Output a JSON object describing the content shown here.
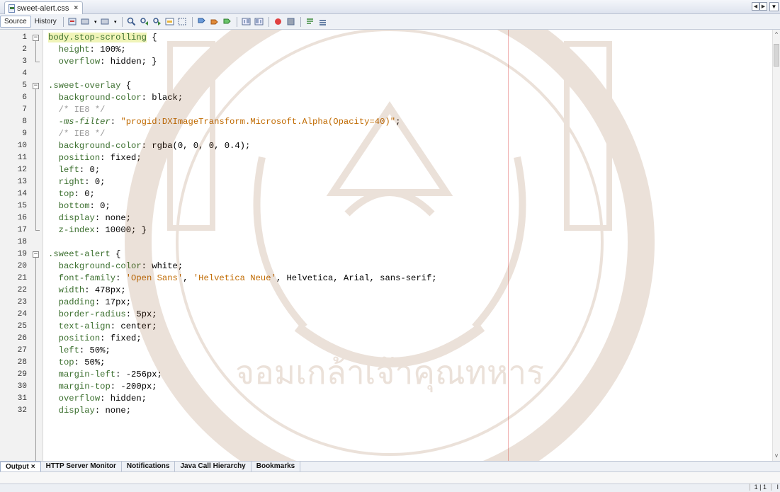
{
  "editor_tab": {
    "filename": "sweet-alert.css",
    "close": "×"
  },
  "toolbar": {
    "source": "Source",
    "history": "History"
  },
  "code_lines": [
    {
      "n": "1",
      "fold": "open",
      "parts": [
        [
          "sel-hl",
          "body.stop-scrolling"
        ],
        [
          "",
          " {"
        ]
      ]
    },
    {
      "n": "2",
      "parts": [
        [
          "",
          "  "
        ],
        [
          "prop",
          "height"
        ],
        [
          "",
          ": 100%;"
        ]
      ]
    },
    {
      "n": "3",
      "fold": "end",
      "parts": [
        [
          "",
          "  "
        ],
        [
          "prop",
          "overflow"
        ],
        [
          "",
          ": hidden; }"
        ]
      ]
    },
    {
      "n": "4",
      "parts": []
    },
    {
      "n": "5",
      "fold": "open",
      "parts": [
        [
          "sel",
          ".sweet-overlay"
        ],
        [
          "",
          " {"
        ]
      ]
    },
    {
      "n": "6",
      "parts": [
        [
          "",
          "  "
        ],
        [
          "prop",
          "background-color"
        ],
        [
          "",
          ": black;"
        ]
      ]
    },
    {
      "n": "7",
      "parts": [
        [
          "",
          "  "
        ],
        [
          "cmt",
          "/* IE8 */"
        ]
      ]
    },
    {
      "n": "8",
      "parts": [
        [
          "",
          "  "
        ],
        [
          "prop-i",
          "-ms-filter"
        ],
        [
          "",
          ": "
        ],
        [
          "str",
          "\"progid:DXImageTransform.Microsoft.Alpha(Opacity=40)\""
        ],
        [
          "",
          ";"
        ]
      ]
    },
    {
      "n": "9",
      "parts": [
        [
          "",
          "  "
        ],
        [
          "cmt",
          "/* IE8 */"
        ]
      ]
    },
    {
      "n": "10",
      "parts": [
        [
          "",
          "  "
        ],
        [
          "prop",
          "background-color"
        ],
        [
          "",
          ": rgba(0, 0, 0, 0.4);"
        ]
      ]
    },
    {
      "n": "11",
      "parts": [
        [
          "",
          "  "
        ],
        [
          "prop",
          "position"
        ],
        [
          "",
          ": fixed;"
        ]
      ]
    },
    {
      "n": "12",
      "parts": [
        [
          "",
          "  "
        ],
        [
          "prop",
          "left"
        ],
        [
          "",
          ": 0;"
        ]
      ]
    },
    {
      "n": "13",
      "parts": [
        [
          "",
          "  "
        ],
        [
          "prop",
          "right"
        ],
        [
          "",
          ": 0;"
        ]
      ]
    },
    {
      "n": "14",
      "parts": [
        [
          "",
          "  "
        ],
        [
          "prop",
          "top"
        ],
        [
          "",
          ": 0;"
        ]
      ]
    },
    {
      "n": "15",
      "parts": [
        [
          "",
          "  "
        ],
        [
          "prop",
          "bottom"
        ],
        [
          "",
          ": 0;"
        ]
      ]
    },
    {
      "n": "16",
      "parts": [
        [
          "",
          "  "
        ],
        [
          "prop",
          "display"
        ],
        [
          "",
          ": none;"
        ]
      ]
    },
    {
      "n": "17",
      "fold": "end",
      "parts": [
        [
          "",
          "  "
        ],
        [
          "prop",
          "z-index"
        ],
        [
          "",
          ": 10000; }"
        ]
      ]
    },
    {
      "n": "18",
      "parts": []
    },
    {
      "n": "19",
      "fold": "open",
      "parts": [
        [
          "sel",
          ".sweet-alert"
        ],
        [
          "",
          " {"
        ]
      ]
    },
    {
      "n": "20",
      "parts": [
        [
          "",
          "  "
        ],
        [
          "prop",
          "background-color"
        ],
        [
          "",
          ": white;"
        ]
      ]
    },
    {
      "n": "21",
      "parts": [
        [
          "",
          "  "
        ],
        [
          "prop",
          "font-family"
        ],
        [
          "",
          ": "
        ],
        [
          "str",
          "'Open Sans'"
        ],
        [
          "",
          ", "
        ],
        [
          "str",
          "'Helvetica Neue'"
        ],
        [
          "",
          ", Helvetica, Arial, sans-serif;"
        ]
      ]
    },
    {
      "n": "22",
      "parts": [
        [
          "",
          "  "
        ],
        [
          "prop",
          "width"
        ],
        [
          "",
          ": 478px;"
        ]
      ]
    },
    {
      "n": "23",
      "parts": [
        [
          "",
          "  "
        ],
        [
          "prop",
          "padding"
        ],
        [
          "",
          ": 17px;"
        ]
      ]
    },
    {
      "n": "24",
      "parts": [
        [
          "",
          "  "
        ],
        [
          "prop",
          "border-radius"
        ],
        [
          "",
          ": 5px;"
        ]
      ]
    },
    {
      "n": "25",
      "parts": [
        [
          "",
          "  "
        ],
        [
          "prop",
          "text-align"
        ],
        [
          "",
          ": center;"
        ]
      ]
    },
    {
      "n": "26",
      "parts": [
        [
          "",
          "  "
        ],
        [
          "prop",
          "position"
        ],
        [
          "",
          ": fixed;"
        ]
      ]
    },
    {
      "n": "27",
      "parts": [
        [
          "",
          "  "
        ],
        [
          "prop",
          "left"
        ],
        [
          "",
          ": 50%;"
        ]
      ]
    },
    {
      "n": "28",
      "parts": [
        [
          "",
          "  "
        ],
        [
          "prop",
          "top"
        ],
        [
          "",
          ": 50%;"
        ]
      ]
    },
    {
      "n": "29",
      "parts": [
        [
          "",
          "  "
        ],
        [
          "prop",
          "margin-left"
        ],
        [
          "",
          ": -256px;"
        ]
      ]
    },
    {
      "n": "30",
      "parts": [
        [
          "",
          "  "
        ],
        [
          "prop",
          "margin-top"
        ],
        [
          "",
          ": -200px;"
        ]
      ]
    },
    {
      "n": "31",
      "parts": [
        [
          "",
          "  "
        ],
        [
          "prop",
          "overflow"
        ],
        [
          "",
          ": hidden;"
        ]
      ]
    },
    {
      "n": "32",
      "parts": [
        [
          "",
          "  "
        ],
        [
          "prop",
          "display"
        ],
        [
          "",
          ": none;"
        ]
      ]
    }
  ],
  "output_tabs": [
    {
      "label": "Output",
      "close": "×",
      "active": true
    },
    {
      "label": "HTTP Server Monitor"
    },
    {
      "label": "Notifications"
    },
    {
      "label": "Java Call Hierarchy"
    },
    {
      "label": "Bookmarks"
    }
  ],
  "status": {
    "position": "1 | 1",
    "mode": "I"
  },
  "watermark_text": "จอมเกล้าเจ้าคุณทหาร",
  "colors": {
    "selector": "#3b6f2e",
    "selector_highlight": "#f0f4b8",
    "string": "#c06a00",
    "comment": "#9a9a9a",
    "margin_guide": "#f1b3b3"
  },
  "icons": {
    "file": "css-file-icon",
    "tab_nav": [
      "scroll-left-icon",
      "scroll-right-icon"
    ],
    "tab_menu": "tab-list-dropdown-icon"
  }
}
